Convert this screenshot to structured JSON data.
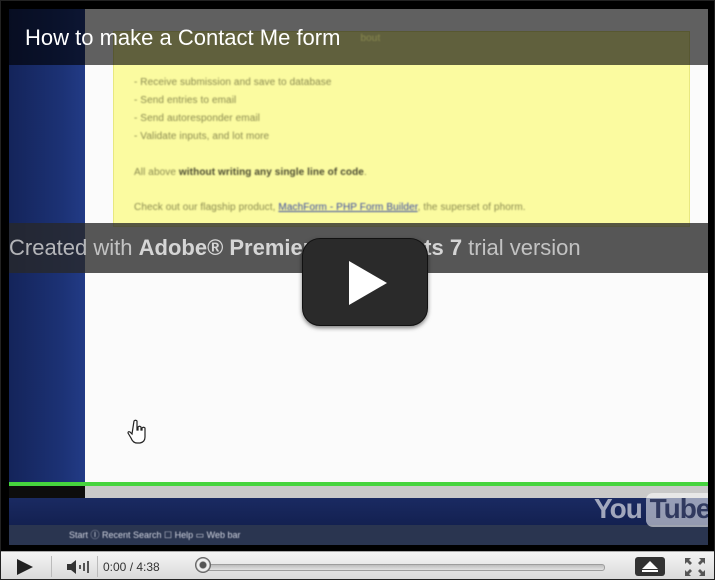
{
  "video": {
    "title": "How to make a Contact Me form",
    "title_tail": "bout",
    "body_lines": [
      "- Receive submission and save to database",
      "- Send entries to email",
      "- Send autoresponder email",
      "- Validate inputs, and lot more"
    ],
    "all_above_prefix": "All above ",
    "all_above_bold": "without writing any single line of code",
    "all_above_suffix": ".",
    "checkout_prefix": "Check out our flagship product, ",
    "checkout_link": "MachForm - PHP Form Builder",
    "checkout_suffix": ", the superset of phorm.",
    "watermark_prefix": "Created with ",
    "watermark_brand": "Adobe® Premiere® Elements 7",
    "watermark_suffix": " trial version",
    "taskbar_text": "Start   Ⓘ Recent   Search   ☐ Help   ▭ Web bar",
    "logo_you": "You",
    "logo_tube": "Tube"
  },
  "controls": {
    "current_time": "0:00",
    "separator": " / ",
    "duration": "4:38",
    "progress_fraction": 0
  },
  "icons": {
    "play_overlay": "large-play-icon",
    "play": "play-icon",
    "volume": "volume-icon",
    "size": "toggle-size-icon",
    "fullscreen": "fullscreen-icon",
    "cursor": "hand-cursor-icon"
  },
  "colors": {
    "highlight": "#fbfba0",
    "progress_line": "#46d43e",
    "rail": "#1c3275"
  }
}
